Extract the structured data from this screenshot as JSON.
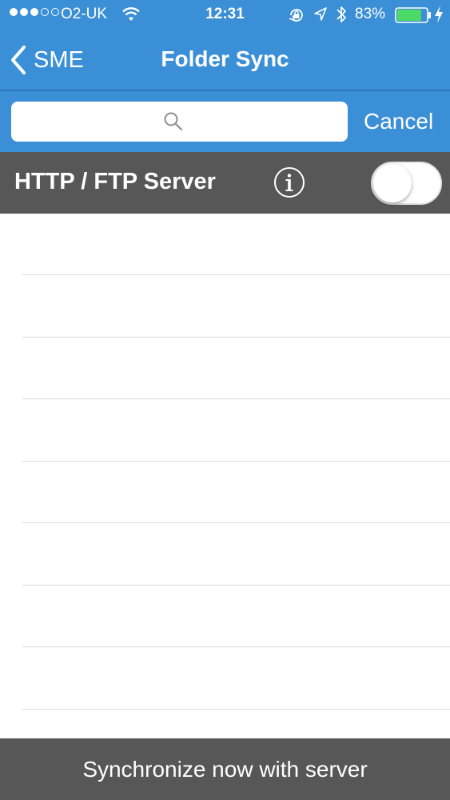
{
  "status_bar": {
    "carrier": "O2-UK",
    "time": "12:31",
    "battery_percent": "83%",
    "battery_level": 0.83,
    "signal_bars_filled": 3,
    "signal_bars_total": 5
  },
  "nav": {
    "back_label": "SME",
    "title": "Folder Sync"
  },
  "search": {
    "value": "",
    "placeholder": "",
    "cancel_label": "Cancel"
  },
  "server": {
    "label": "HTTP / FTP Server",
    "enabled": false
  },
  "list": {
    "rows": [
      "",
      "",
      "",
      "",
      "",
      "",
      "",
      ""
    ]
  },
  "footer": {
    "sync_label": "Synchronize now with server"
  },
  "colors": {
    "accent_blue": "#3a8fd6",
    "dark_bar": "#575757",
    "battery_green": "#4cd964"
  }
}
